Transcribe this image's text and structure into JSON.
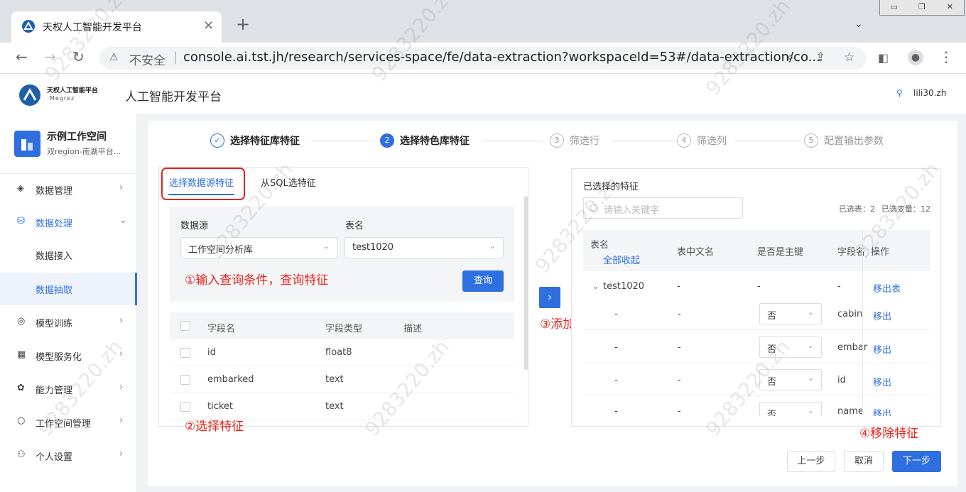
{
  "browser": {
    "tab_title": "天权人工智能开发平台",
    "tab_close": "×",
    "new_tab": "+",
    "security": "不安全",
    "url": "console.ai.tst.jh/research/services-space/fe/data-extraction?workspaceId=53#/data-extraction/co...",
    "icons": [
      "back-icon",
      "forward-icon",
      "reload-icon",
      "warning-icon",
      "zoom-icon",
      "share-icon",
      "star-icon",
      "sidepanel-icon",
      "profile-icon",
      "menu-icon"
    ]
  },
  "header": {
    "logo_name": "天权人工智能平台",
    "logo_sub": "Megrez",
    "platform_title": "人工智能开发平台",
    "user": "lili30.zh"
  },
  "workspace": {
    "name": "示例工作空间",
    "sub": "双region-南湖平台..."
  },
  "sidebar": {
    "items": [
      {
        "label": "数据管理",
        "icon": "layers-icon"
      },
      {
        "label": "数据处理",
        "icon": "database-icon"
      },
      {
        "label": "数据接入"
      },
      {
        "label": "数据抽取"
      },
      {
        "label": "模型训练",
        "icon": "model-icon"
      },
      {
        "label": "模型服务化",
        "icon": "calendar-icon"
      },
      {
        "label": "能力管理",
        "icon": "capability-icon"
      },
      {
        "label": "工作空间管理",
        "icon": "cube-icon"
      },
      {
        "label": "个人设置",
        "icon": "person-icon"
      }
    ]
  },
  "steps": [
    {
      "num": "✓",
      "label": "选择特征库特征"
    },
    {
      "num": "2",
      "label": "选择特色库特征"
    },
    {
      "num": "3",
      "label": "筛选行"
    },
    {
      "num": "4",
      "label": "筛选列"
    },
    {
      "num": "5",
      "label": "配置输出参数"
    }
  ],
  "left": {
    "tab_source": "选择数据源特征",
    "tab_sql": "从SQL选特征",
    "datasource_label": "数据源",
    "datasource_value": "工作空间分析库",
    "table_label": "表名",
    "table_value": "test1020",
    "query_btn": "查询",
    "columns": [
      "字段名",
      "字段类型",
      "描述"
    ],
    "rows": [
      {
        "name": "id",
        "type": "float8"
      },
      {
        "name": "embarked",
        "type": "text"
      },
      {
        "name": "ticket",
        "type": "text"
      }
    ]
  },
  "add_btn": "›",
  "right": {
    "title": "已选择的特征",
    "search_placeholder": "请输入关键字",
    "stat_tables": "已选表：2",
    "stat_vars": "已选变量：12",
    "columns": {
      "table": "表名",
      "collapse": "全部收起",
      "cn_name": "表中文名",
      "pk": "是否是主键",
      "field": "字段名",
      "op": "操作"
    },
    "table_row": {
      "name": "test1020",
      "cn": "-",
      "pk": "-",
      "field": "-",
      "op": "移出表"
    },
    "rows": [
      {
        "t": "-",
        "cn": "-",
        "pk": "否",
        "field": "cabin",
        "op": "移出"
      },
      {
        "t": "-",
        "cn": "-",
        "pk": "否",
        "field": "embar",
        "op": "移出"
      },
      {
        "t": "-",
        "cn": "-",
        "pk": "否",
        "field": "id",
        "op": "移出"
      },
      {
        "t": "-",
        "cn": "-",
        "pk": "否",
        "field": "name",
        "op": "移出"
      }
    ]
  },
  "annotations": {
    "a1": "①输入查询条件，查询特征",
    "a2": "②选择特征",
    "a3": "③添加",
    "a4": "④移除特征"
  },
  "footer": {
    "prev": "上一步",
    "cancel": "取消",
    "next": "下一步"
  },
  "watermark": "9283220.zh"
}
